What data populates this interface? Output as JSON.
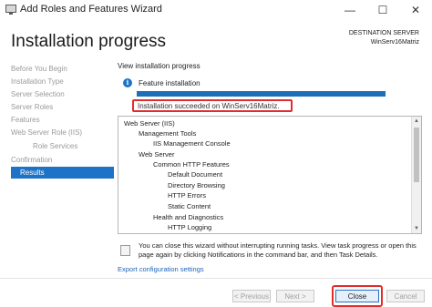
{
  "window": {
    "title": "Add Roles and Features Wizard",
    "minimize_glyph": "—",
    "maximize_glyph": "☐",
    "close_glyph": "✕"
  },
  "header": {
    "heading": "Installation progress",
    "destination_label": "DESTINATION SERVER",
    "destination_server": "WinServ16Matriz"
  },
  "nav": {
    "items": [
      {
        "label": "Before You Begin",
        "sub": false,
        "active": false
      },
      {
        "label": "Installation Type",
        "sub": false,
        "active": false
      },
      {
        "label": "Server Selection",
        "sub": false,
        "active": false
      },
      {
        "label": "Server Roles",
        "sub": false,
        "active": false
      },
      {
        "label": "Features",
        "sub": false,
        "active": false
      },
      {
        "label": "Web Server Role (IIS)",
        "sub": false,
        "active": false
      },
      {
        "label": "Role Services",
        "sub": true,
        "active": false
      },
      {
        "label": "Confirmation",
        "sub": false,
        "active": false
      },
      {
        "label": "Results",
        "sub": false,
        "active": true
      }
    ]
  },
  "main": {
    "view_label": "View installation progress",
    "info_glyph": "i",
    "feature_label": "Feature installation",
    "progress_fraction": 1.0,
    "success_text": "Installation succeeded on WinServ16Matriz.",
    "tree": [
      {
        "text": "Web Server (IIS)",
        "level": 0
      },
      {
        "text": "Management Tools",
        "level": 1
      },
      {
        "text": "IIS Management Console",
        "level": 2
      },
      {
        "text": "Web Server",
        "level": 1
      },
      {
        "text": "Common HTTP Features",
        "level": 2
      },
      {
        "text": "Default Document",
        "level": 3
      },
      {
        "text": "Directory Browsing",
        "level": 3
      },
      {
        "text": "HTTP Errors",
        "level": 3
      },
      {
        "text": "Static Content",
        "level": 3
      },
      {
        "text": "Health and Diagnostics",
        "level": 2
      },
      {
        "text": "HTTP Logging",
        "level": 3
      }
    ],
    "note_text": "You can close this wizard without interrupting running tasks. View task progress or open this page again by clicking Notifications in the command bar, and then Task Details.",
    "export_link": "Export configuration settings"
  },
  "footer": {
    "previous_label": "< Previous",
    "next_label": "Next >",
    "close_label": "Close",
    "cancel_label": "Cancel"
  },
  "colors": {
    "accent": "#1e73c7",
    "highlight_red": "#e12d2d",
    "progress": "#1d6fb8"
  }
}
